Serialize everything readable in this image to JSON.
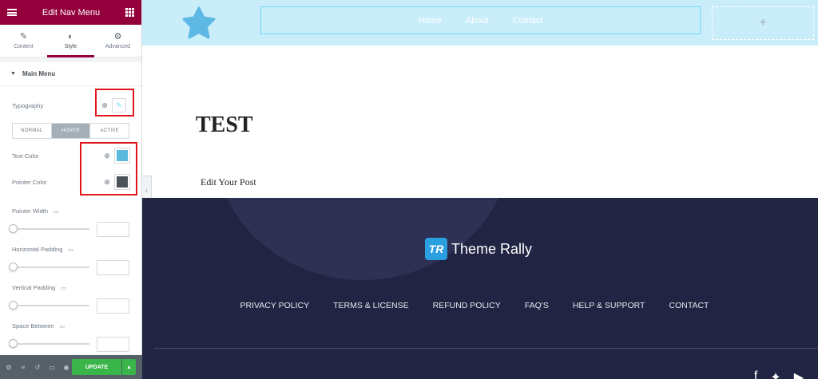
{
  "panel": {
    "title": "Edit Nav Menu",
    "tabs": [
      {
        "label": "Content",
        "icon": "pencil-icon"
      },
      {
        "label": "Style",
        "icon": "half-circle-icon"
      },
      {
        "label": "Advanced",
        "icon": "gear-icon"
      }
    ],
    "active_tab": "Style",
    "section": "Main Menu",
    "typography_label": "Typography",
    "states": [
      "NORMAL",
      "HOVER",
      "ACTIVE"
    ],
    "active_state": "HOVER",
    "text_color_label": "Text Color",
    "text_color": "#5bb8de",
    "pointer_color_label": "Pointer Color",
    "pointer_color": "#4b5259",
    "sliders": [
      "Pointer Width",
      "Horizontal Padding",
      "Vertical Padding",
      "Space Between"
    ],
    "update_label": "UPDATE",
    "accent": "#93003c"
  },
  "site": {
    "nav": [
      "Home",
      "About",
      "Contact"
    ],
    "add_symbol": "+",
    "post_title": "TEST",
    "post_link": "Edit Your Post",
    "brand_badge": "TR",
    "brand_name": "Theme Rally",
    "footer_links": [
      "PRIVACY POLICY",
      "TERMS & LICENSE",
      "REFUND POLICY",
      "FAQ'S",
      "HELP & SUPPORT",
      "CONTACT"
    ],
    "social": [
      "facebook-icon",
      "twitter-icon",
      "youtube-icon"
    ],
    "header_bg": "#c9eefa",
    "footer_bg": "#222443"
  }
}
